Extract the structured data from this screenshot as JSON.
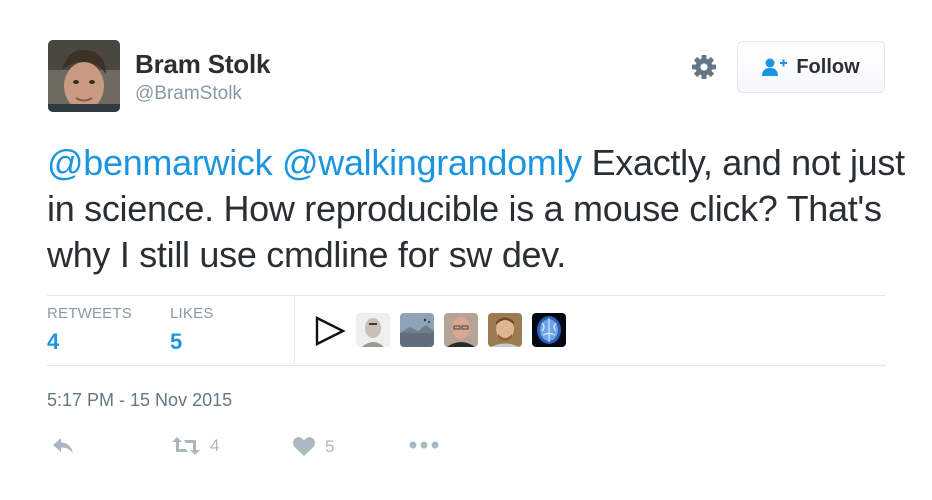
{
  "user": {
    "name": "Bram Stolk",
    "handle": "@BramStolk",
    "follow_label": "Follow"
  },
  "tweet": {
    "mention_1": "@benmarwick",
    "mention_2": "@walkingrandomly",
    "text_after_mentions": " Exactly, and not just in science. How reproducible is a mouse click? That's why I still use cmdline for sw dev."
  },
  "stats": {
    "retweets_label": "RETWEETS",
    "retweets_count": "4",
    "likes_label": "LIKES",
    "likes_count": "5"
  },
  "liked_by_icons": [
    "play-icon",
    "avatar-bald-man",
    "avatar-landscape",
    "avatar-man-glasses",
    "avatar-man-beard",
    "avatar-brain-scan"
  ],
  "timestamp": "5:17 PM - 15 Nov 2015",
  "actions": {
    "reply_icon": "reply-icon",
    "retweet_count": "4",
    "like_count": "5",
    "more_icon": "more-dots-icon"
  },
  "colors": {
    "link": "#1b95e0",
    "text": "#292f33",
    "muted": "#8899a6",
    "action_icon": "#aab8c2",
    "divider": "#e1e8ed"
  }
}
